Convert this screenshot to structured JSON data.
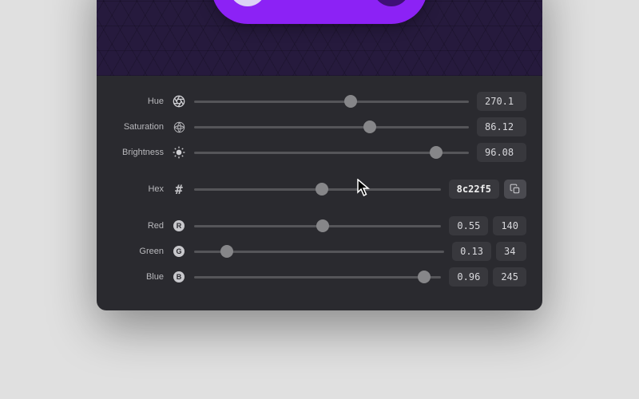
{
  "preview": {
    "swatch_color": "#8c22f5",
    "dot_left_color": "#dcd2f5",
    "dot_right_color": "#3f1077"
  },
  "hsb": {
    "hue": {
      "label": "Hue",
      "value": "270.1",
      "percent": 57
    },
    "saturation": {
      "label": "Saturation",
      "value": "86.12",
      "percent": 64
    },
    "brightness": {
      "label": "Brightness",
      "value": "96.08",
      "percent": 88
    }
  },
  "hex": {
    "label": "Hex",
    "value": "8c22f5",
    "percent": 52
  },
  "rgb": {
    "red": {
      "label": "Red",
      "badge": "R",
      "float": "0.55",
      "int": "140",
      "percent": 52
    },
    "green": {
      "label": "Green",
      "badge": "G",
      "float": "0.13",
      "int": "34",
      "percent": 13
    },
    "blue": {
      "label": "Blue",
      "badge": "B",
      "float": "0.96",
      "int": "245",
      "percent": 93
    }
  }
}
